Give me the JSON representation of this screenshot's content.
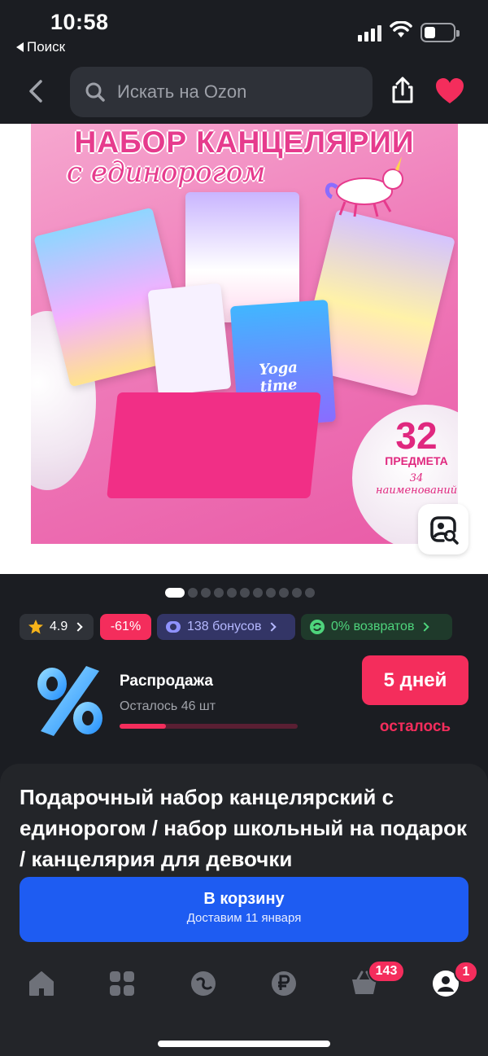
{
  "status_bar": {
    "time": "10:58",
    "back_app": "Поиск"
  },
  "header": {
    "search_placeholder": "Искать на Ozon"
  },
  "product_image": {
    "heading": "НАБОР КАНЦЕЛЯРИИ",
    "subheading": "с единорогом",
    "count_number": "32",
    "count_label": "ПРЕДМЕТА",
    "count_sub": "34 наименований",
    "notebook_text": "Yoga time",
    "dots_total": 11,
    "dots_active": 1
  },
  "chips": {
    "rating": "4.9",
    "discount": "-61%",
    "bonus": "138 бонусов",
    "returns": "0% возвратов"
  },
  "sale": {
    "title": "Распродажа",
    "left_text": "Осталось 46 шт",
    "progress_fraction": 0.26,
    "days_label": "5 дней",
    "days_sub": "осталось"
  },
  "product": {
    "title": "Подарочный набор канцелярский с единорогом / набор школьный на подарок / канцелярия для девочки"
  },
  "cart_button": {
    "label": "В корзину",
    "delivery": "Доставим 11 января"
  },
  "tabbar": {
    "cart_badge": "143",
    "profile_badge": "1"
  },
  "colors": {
    "accent_red": "#f42d5c",
    "cart_blue": "#1e5cf2",
    "background": "#1b1d22"
  }
}
